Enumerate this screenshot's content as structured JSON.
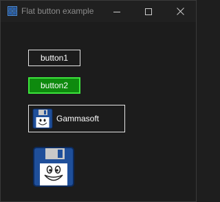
{
  "window": {
    "title": "Flat button example",
    "icons": {
      "app": "app-window-icon",
      "minimize": "minimize-icon",
      "maximize": "maximize-icon",
      "close": "close-icon"
    }
  },
  "buttons": {
    "button1_label": "button1",
    "button2_label": "button2",
    "button3_label": "Gammasoft",
    "button3_icon": "floppy-disk-icon",
    "image_button_icon": "floppy-disk-icon"
  },
  "colors": {
    "button2_fill": "#0e8a0e",
    "button2_border": "#3de63d",
    "floppy_blue": "#1f4f9a"
  }
}
